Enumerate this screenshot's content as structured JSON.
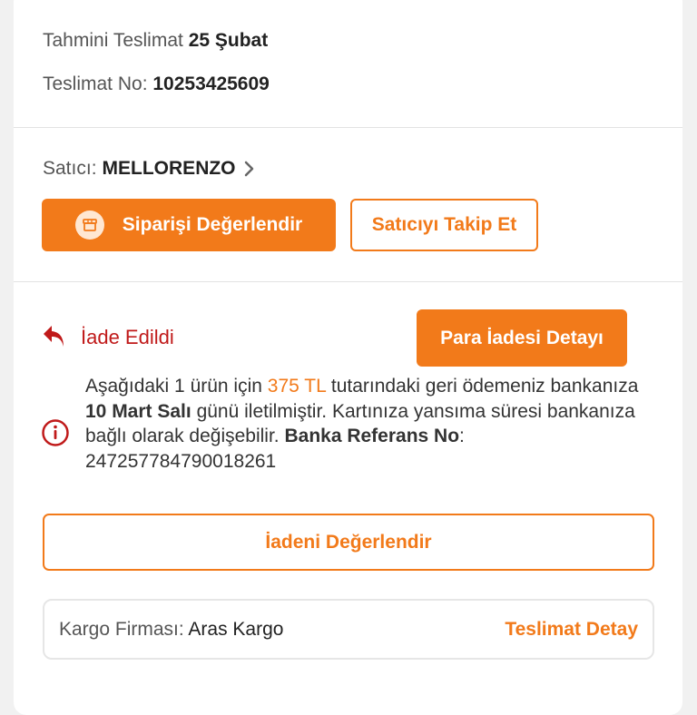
{
  "delivery": {
    "estimated_label": "Tahmini Teslimat",
    "estimated_value": "25 Şubat",
    "number_label": "Teslimat No:",
    "number_value": "10253425609"
  },
  "seller": {
    "label": "Satıcı:",
    "name": "MELLORENZO",
    "rate_order_button": "Siparişi Değerlendir",
    "follow_button": "Satıcıyı Takip Et"
  },
  "refund": {
    "status_label": "İade Edildi",
    "detail_button": "Para İadesi Detayı",
    "info_part1": "Aşağıdaki 1 ürün için ",
    "info_amount": "375 TL",
    "info_part2": " tutarındaki geri ödemeniz bankanıza ",
    "info_date": "10 Mart Salı",
    "info_part3": " günü iletilmiştir. Kartınıza yansıma süresi bankanıza bağlı olarak değişebilir. ",
    "info_ref_label": "Banka Referans No",
    "info_ref_sep": ": ",
    "info_ref_value": "247257784790018261",
    "rate_return_button": "İadeni Değerlendir"
  },
  "cargo": {
    "label": "Kargo Firması:",
    "company": "Aras Kargo",
    "detail_link": "Teslimat Detay"
  },
  "colors": {
    "accent": "#f27a1a",
    "refund_red": "#c01a1a"
  }
}
